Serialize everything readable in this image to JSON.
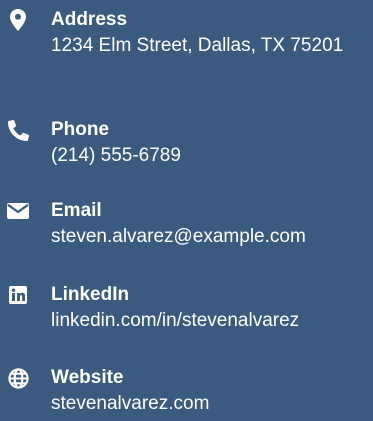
{
  "colors": {
    "background": "#3a5a80",
    "text": "#ffffff"
  },
  "contacts": [
    {
      "label": "Address",
      "value": "1234 Elm Street, Dallas, TX 75201",
      "icon": "map-marker-icon"
    },
    {
      "label": "Phone",
      "value": "(214) 555-6789",
      "icon": "phone-icon"
    },
    {
      "label": "Email",
      "value": "steven.alvarez@example.com",
      "icon": "envelope-icon"
    },
    {
      "label": "LinkedIn",
      "value": "linkedin.com/in/stevenalvarez",
      "icon": "linkedin-icon"
    },
    {
      "label": "Website",
      "value": "stevenalvarez.com",
      "icon": "globe-icon"
    }
  ]
}
